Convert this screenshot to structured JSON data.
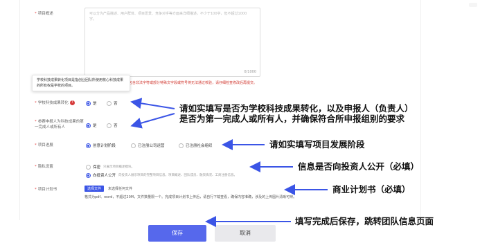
{
  "form": {
    "overview_label": "项目概述",
    "overview_placeholder": "可以分为产品描述、用户群体、项目愿景、竞争对手等方面来详细描述，不少于100字，但不超过1000字。",
    "overview_counter": "0/1000",
    "overview_warning": "内容包含非法字符或部分特殊文字段或符号将无法通过校验，请仔细检查修改后再提交。",
    "tooltip_text": "学校科技成果转化项目是指创业团队所使用核心科技成果的所有权是学校的项目。",
    "school_label": "学校科技成果转化",
    "school_yes": "是",
    "school_no": "否",
    "owner_label": "参赛申报人为科技成果的第一完成人或所有人",
    "owner_yes": "是",
    "owner_no": "否",
    "stage_label": "项目进展",
    "stage_opt1": "创意计划阶段",
    "stage_opt2": "已注册公司运营",
    "stage_opt3": "已注册社会组织",
    "privacy_label": "隐私设置",
    "privacy_opt1": "保密",
    "privacy_opt1_note": "只展示项目概述模块。",
    "privacy_opt2": "向投资人公开",
    "privacy_opt2_note": "向投资人展示项目的完整项目信息，项目概述、团队成员、融资情况、工商注册信息。",
    "plan_label": "项目计划书",
    "file_button": "选择文件",
    "no_file": "未选择任何文件",
    "file_format": "格式为pdf、word，不超过20M，文件数量限一个。完成项目计划书上传后，请自行下载查看，确保内容准确，涉及的上传图片清晰可辨。"
  },
  "buttons": {
    "save": "保存",
    "cancel": "取消"
  },
  "annotations": {
    "a1_line1": "请如实填写是否为学校科技成果转化，以及申报人（负责人）",
    "a1_line2": "是否为第一完成人或所有人，并确保符合所申报组别的要求",
    "a2": "请如实填写项目发展阶段",
    "a3": "信息是否向投资人公开（必填）",
    "a4": "商业计划书（必填）",
    "a5": "填写完成后保存，跳转团队信息页面"
  },
  "colors": {
    "primary": "#5668ec",
    "required": "#e64545",
    "arrow": "#3b55e6"
  }
}
